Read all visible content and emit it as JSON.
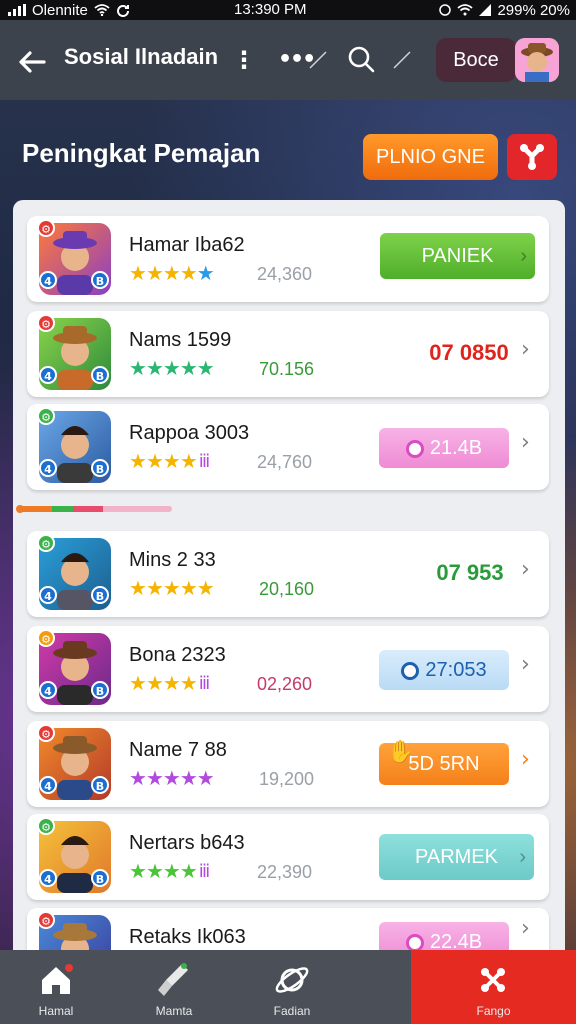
{
  "status_bar": {
    "carrier": "Olennite",
    "time": "13:390 PM",
    "battery_text": "299% 20%"
  },
  "topbar": {
    "title": "Sosial Ilnadain",
    "box_label": "Boce",
    "icons": [
      "back-arrow-icon",
      "kebab-icon",
      "more-icon",
      "search-icon",
      "avatar"
    ]
  },
  "header": {
    "title": "Peningkat Pemajan",
    "primary_button": "PLNIO GNE",
    "secondary_icon": "puzzle-icon"
  },
  "players": [
    {
      "name": "Hamar Iba62",
      "score": "24,360",
      "stars": 4,
      "star_color": "#f5b400",
      "extra_star_color": "#2a9be8",
      "action": "PANIEK",
      "action_style": "green-button",
      "badge_color": "#e53935"
    },
    {
      "name": "Nams 1599",
      "score": "70.156",
      "stars": 5,
      "star_color": "#2bb673",
      "action": "07 0850",
      "action_style": "red-text",
      "badge_color": "#e53935"
    },
    {
      "name": "Rappoa 3003",
      "score": "24,760",
      "stars": 4,
      "star_color": "#f5b400",
      "action": "21.4B",
      "action_style": "pink-button",
      "badge_color": "#3bb14a"
    },
    {
      "name": "Mins 2 33",
      "score": "20,160",
      "stars": 5,
      "star_color": "#f5b400",
      "action": "07 953",
      "action_style": "green-badge",
      "badge_color": "#3bb14a"
    },
    {
      "name": "Bona 2323",
      "score": "02,260",
      "stars": 4,
      "star_color": "#f5b400",
      "action": "27:053",
      "action_style": "blue-button",
      "badge_color": "#f59a0c"
    },
    {
      "name": "Name 7 88",
      "score": "19,200",
      "stars": 5,
      "star_color": "#b24adf",
      "action": "5D 5RN",
      "action_style": "orange-button",
      "badge_color": "#e53935"
    },
    {
      "name": "Nertars b643",
      "score": "22,390",
      "stars": 4,
      "star_color": "#4cc43a",
      "action": "PARMEK",
      "action_style": "teal-button",
      "badge_color": "#3bb14a"
    },
    {
      "name": "Retaks Ik063",
      "score": "",
      "stars": 0,
      "star_color": "#f5b400",
      "action": "22.4B",
      "action_style": "pink-button",
      "badge_color": "#e53935"
    }
  ],
  "progress": {
    "value": 0.55
  },
  "bottom_nav": [
    {
      "label": "Hamal",
      "icon": "home-icon"
    },
    {
      "label": "Mamta",
      "icon": "broom-icon"
    },
    {
      "label": "Fadian",
      "icon": "planet-icon"
    },
    {
      "label": "Fango",
      "icon": "puzzle-icon",
      "active": true
    }
  ]
}
